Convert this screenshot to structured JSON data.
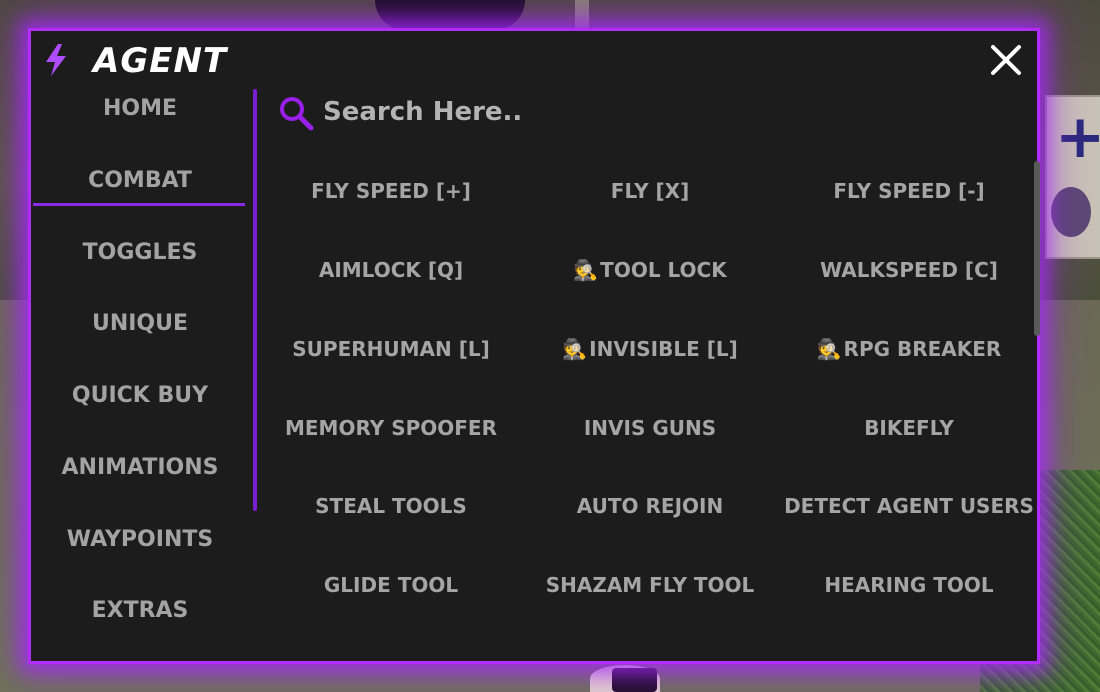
{
  "app": {
    "title": "AGENT",
    "accent_color": "#b02cff",
    "icons": {
      "title": "lightning-bolt-icon",
      "close": "close-icon",
      "search": "magnifier-icon"
    }
  },
  "sidebar": {
    "items": [
      {
        "label": "HOME"
      },
      {
        "label": "COMBAT",
        "active": true
      },
      {
        "label": "TOGGLES"
      },
      {
        "label": "UNIQUE"
      },
      {
        "label": "QUICK BUY"
      },
      {
        "label": "ANIMATIONS"
      },
      {
        "label": "WAYPOINTS"
      },
      {
        "label": "EXTRAS"
      }
    ]
  },
  "search": {
    "placeholder": "Search Here.."
  },
  "buttons": [
    {
      "label": "FLY SPEED [+]"
    },
    {
      "label": "FLY [X]"
    },
    {
      "label": "FLY SPEED [-]"
    },
    {
      "label": "AIMLOCK [Q]"
    },
    {
      "label": "TOOL LOCK",
      "emoji": "🕵"
    },
    {
      "label": "WALKSPEED [C]"
    },
    {
      "label": "SUPERHUMAN [L]"
    },
    {
      "label": "INVISIBLE [L]",
      "emoji": "🕵"
    },
    {
      "label": "RPG BREAKER",
      "emoji": "🕵"
    },
    {
      "label": "MEMORY SPOOFER"
    },
    {
      "label": "INVIS GUNS"
    },
    {
      "label": "BIKEFLY"
    },
    {
      "label": "STEAL TOOLS"
    },
    {
      "label": "AUTO REJOIN"
    },
    {
      "label": "DETECT AGENT USERS"
    },
    {
      "label": "GLIDE TOOL"
    },
    {
      "label": "SHAZAM FLY TOOL"
    },
    {
      "label": "HEARING TOOL"
    }
  ]
}
